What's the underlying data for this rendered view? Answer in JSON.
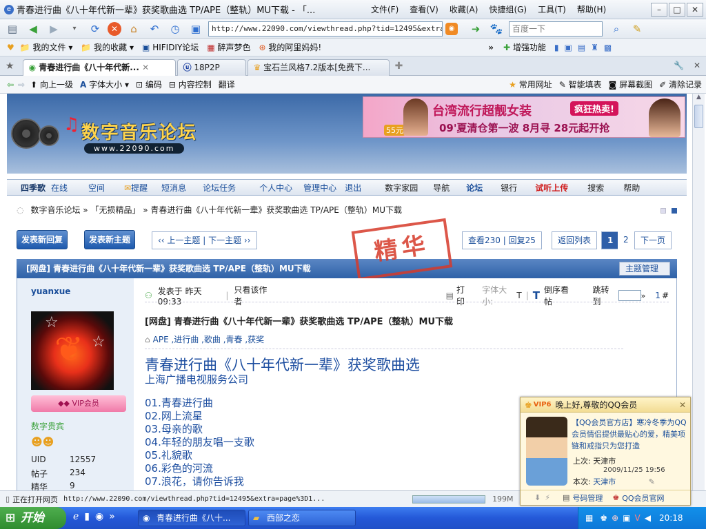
{
  "window": {
    "title": "青春进行曲《八十年代新一辈》获奖歌曲选 TP/APE（整轨）MU下载 - 「...",
    "menu": [
      "文件(F)",
      "查看(V)",
      "收藏(A)",
      "快捷组(G)",
      "工具(T)",
      "帮助(H)"
    ]
  },
  "navbar": {
    "address": "http://www.22090.com/viewthread.php?tid=12495&extra",
    "search_placeholder": "百度一下"
  },
  "favorites": [
    "我的文件",
    "我的收藏",
    "HIFIDIY论坛",
    "醉声梦色",
    "我的阿里妈妈!"
  ],
  "favorites_right": "增强功能",
  "tabs": [
    {
      "label": "青春进行曲《八十年代新..."
    },
    {
      "label": "18P2P"
    },
    {
      "label": "宝石兰风格7.2版本[免费下..."
    }
  ],
  "cmdbar": {
    "left": [
      "向上一级",
      "字体大小",
      "编码",
      "内容控制",
      "翻译"
    ],
    "right": [
      "常用网址",
      "智能填表",
      "屏幕截图",
      "清除记录"
    ]
  },
  "site": {
    "logo": "数字音乐论坛",
    "logo_url": "www.22090.com",
    "ad": {
      "line1": "台湾流行超靓女装",
      "badge": "疯狂热卖!",
      "line2": "09'夏清仓第一波 8月寻 28元起开抢",
      "price": "55元"
    },
    "nav": [
      "四季歌",
      "在线",
      "空间",
      "提醒",
      "短消息",
      "论坛任务",
      "个人中心",
      "管理中心",
      "退出",
      "数字家园",
      "导航",
      "论坛",
      "银行",
      "试听上传",
      "搜索",
      "帮助"
    ],
    "breadcrumb": "数字音乐论坛 » 「无损精品」 » 青春进行曲《八十年代新一辈》获奖歌曲选 TP/APE（整轨）MU下载"
  },
  "thread": {
    "reply_btn": "发表新回复",
    "topic_btn": "发表新主题",
    "prevnext": "‹‹ 上一主题 | 下一主题 ››",
    "stats": "查看230 | 回复25",
    "back": "返回列表",
    "pages": [
      "1",
      "2"
    ],
    "next": "下一页",
    "header": "[网盘] 青春进行曲《八十年代新一辈》获奖歌曲选 TP/APE（整轨）MU下载",
    "stamp": "精华",
    "manage": "主题管理"
  },
  "author": {
    "name": "yuanxue",
    "badge": "VIP会员",
    "group": "数字贵宾",
    "stats": [
      {
        "k": "UID",
        "v": "12557"
      },
      {
        "k": "帖子",
        "v": "234"
      },
      {
        "k": "精华",
        "v": "9"
      }
    ]
  },
  "post": {
    "meta": "发表于 昨天 09:33",
    "only_author": "只看该作者",
    "print": "打印",
    "fontsize": "字体大小:",
    "fontsize_t": "T",
    "reverse": "倒序看帖",
    "jump": "跳转到",
    "floor": "1",
    "floor_suffix": "#",
    "title": "[网盘] 青春进行曲《八十年代新一辈》获奖歌曲选 TP/APE（整轨）MU下载",
    "tags": "APE ,进行曲 ,歌曲 ,青春 ,获奖",
    "heading": "青春进行曲《八十年代新一辈》获奖歌曲选",
    "publisher": "上海广播电视服务公司",
    "songs": [
      "01.青春进行曲",
      "02.网上流星",
      "03.母亲的歌",
      "04.年轻的朋友唱一支歌",
      "05.礼貌歌",
      "06.彩色的河流",
      "07.浪花，请你告诉我"
    ]
  },
  "statusbar": {
    "text": "正在打开网页",
    "url": "http://www.22090.com/viewthread.php?tid=12495&extra=page%3D1...",
    "memory": "199M"
  },
  "qq": {
    "title": "晚上好,尊敬的QQ会员",
    "vip": "VIP6",
    "message": "【QQ会员官方店】寒冷冬季为QQ会员情侣提供最贴心的爱，精美项链和戒指只为您打造",
    "last_label": "上次:",
    "last_city": "天津市",
    "last_time": "2009/11/25 19:56",
    "now_label": "本次:",
    "now_city": "天津市",
    "links": [
      "号码管理",
      "QQ会员官网"
    ]
  },
  "taskbar": {
    "start": "开始",
    "items": [
      "青春进行曲《八十...",
      "西部之恋"
    ],
    "clock": "20:18"
  },
  "colors": {
    "taskbar": "#2458d8",
    "link": "#1a4e9a",
    "heading": "#1d4ea0",
    "stamp": "#d63a2a",
    "start": "#2f8c2f"
  }
}
